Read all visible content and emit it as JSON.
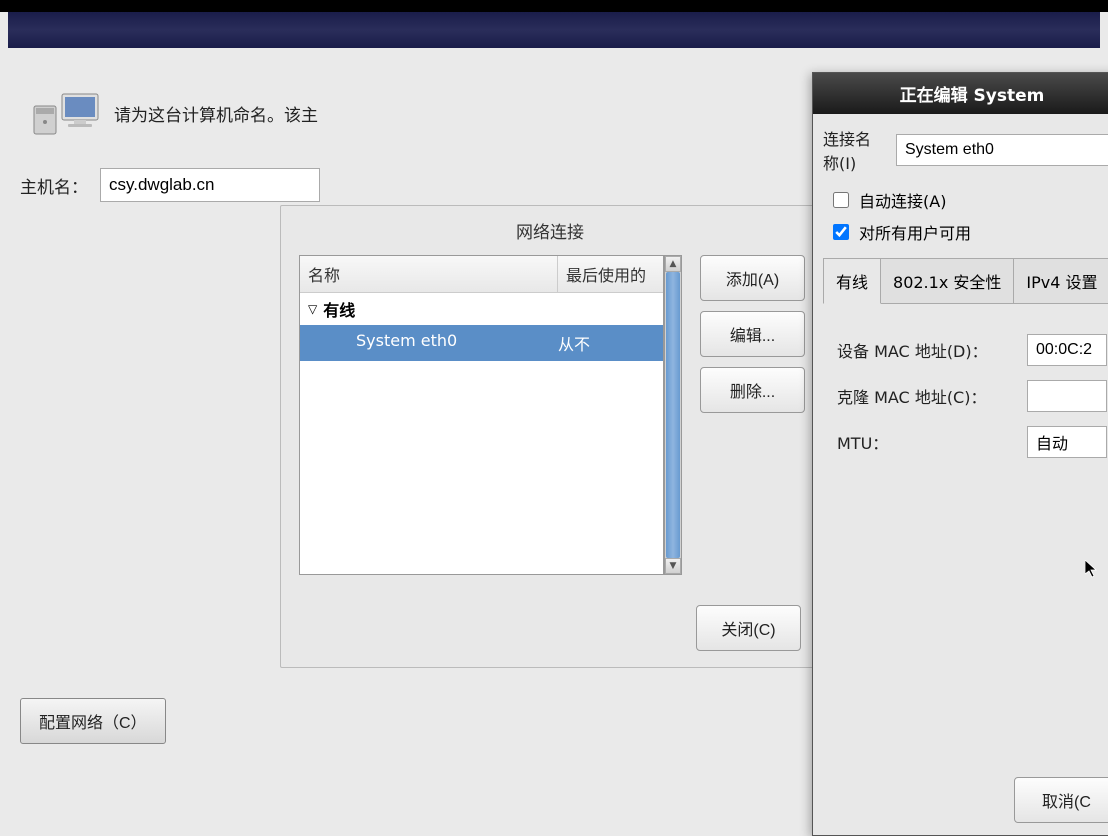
{
  "top": {
    "prompt_text": "请为这台计算机命名。该主",
    "hostname_label": "主机名：",
    "hostname_value": "csy.dwglab.cn",
    "config_network_btn": "配置网络（C）"
  },
  "network_panel": {
    "title": "网络连接",
    "columns": {
      "name": "名称",
      "last_used": "最后使用的"
    },
    "category_wired": "有线",
    "connections": [
      {
        "name": "System eth0",
        "last_used": "从不"
      }
    ],
    "buttons": {
      "add": "添加(A)",
      "edit": "编辑...",
      "delete": "删除...",
      "close": "关闭(C)"
    }
  },
  "edit_dialog": {
    "title": "正在编辑 System",
    "conn_name_label": "连接名称(I)",
    "conn_name_value": "System eth0",
    "auto_connect_label": "自动连接(A)",
    "auto_connect_checked": false,
    "all_users_label": "对所有用户可用",
    "all_users_checked": true,
    "tabs": {
      "wired": "有线",
      "security": "802.1x 安全性",
      "ipv4": "IPv4 设置"
    },
    "fields": {
      "device_mac_label": "设备 MAC 地址(D)：",
      "device_mac_value": "00:0C:2",
      "clone_mac_label": "克隆 MAC 地址(C)：",
      "clone_mac_value": "",
      "mtu_label": "MTU：",
      "mtu_value": "自动"
    },
    "footer": {
      "cancel": "取消(C"
    }
  }
}
